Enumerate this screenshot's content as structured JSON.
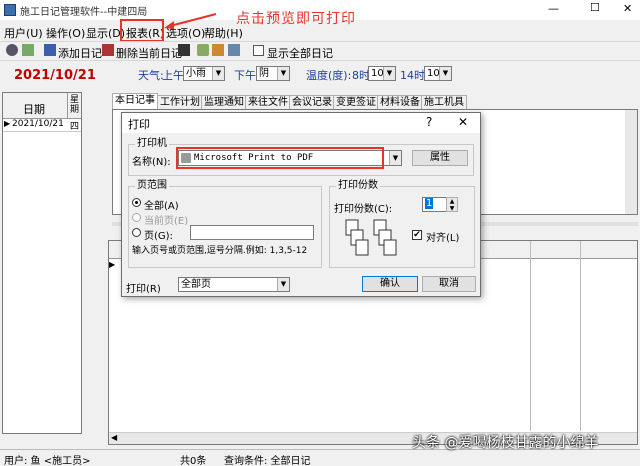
{
  "window": {
    "title": "施工日记管理软件--中建四局",
    "min_btn": "—",
    "max_btn": "☐",
    "close_btn": "✕"
  },
  "menu": [
    {
      "label": "用户(U)"
    },
    {
      "label": "操作(O)"
    },
    {
      "label": "显示(D)"
    },
    {
      "label": "报表(R)"
    },
    {
      "label": "选项(O)"
    },
    {
      "label": "帮助(H)"
    }
  ],
  "annotation": {
    "text": "点击预览即可打印",
    "arrow_color": "#e8332a",
    "text_color": "#e8332a"
  },
  "toolbar": {
    "add_label": "添加日记",
    "delete_label": "删除当前日记",
    "show_all_label": "显示全部日记"
  },
  "date_display": "2021/10/21",
  "weather": {
    "label": "天气:",
    "am_label": "上午",
    "am_value": "小雨",
    "pm_label": "下午",
    "pm_value": "阴",
    "temp_label": "温度(度):",
    "t8_label": "8时",
    "t8_value": "10",
    "t14_label": "14时",
    "t14_value": "10"
  },
  "list": {
    "col_date": "日期",
    "col_week": "星期",
    "rows": [
      {
        "date": "2021/10/21",
        "week": "四"
      }
    ]
  },
  "tabs": [
    "本日记事",
    "工作计划",
    "监理通知",
    "来往文件",
    "会议记录",
    "变更签证",
    "材料设备",
    "施工机具"
  ],
  "dialog": {
    "title": "打印",
    "help": "?",
    "close": "✕",
    "printer_group": "打印机",
    "name_label": "名称(N):",
    "printer_name": "Microsoft Print to PDF",
    "properties_btn": "属性",
    "range_group": "页范围",
    "range_all": "全部(A)",
    "range_current": "当前页(E)",
    "range_pages": "页(G):",
    "range_hint": "输入页号或页范围,逗号分隔.例如: 1,3,5-12",
    "copies_group": "打印份数",
    "copies_label": "打印份数(C):",
    "copies_value": "1",
    "collate_label": "对齐(L)",
    "print_label": "打印(R)",
    "print_value": "全部页",
    "ok_btn": "确认",
    "cancel_btn": "取消"
  },
  "status": {
    "user": "用户: 鱼 <施工员>",
    "count": "共0条",
    "query": "查询条件: 全部日记"
  },
  "watermark": "头条 @爱喝杨枝甘露的小绵羊"
}
